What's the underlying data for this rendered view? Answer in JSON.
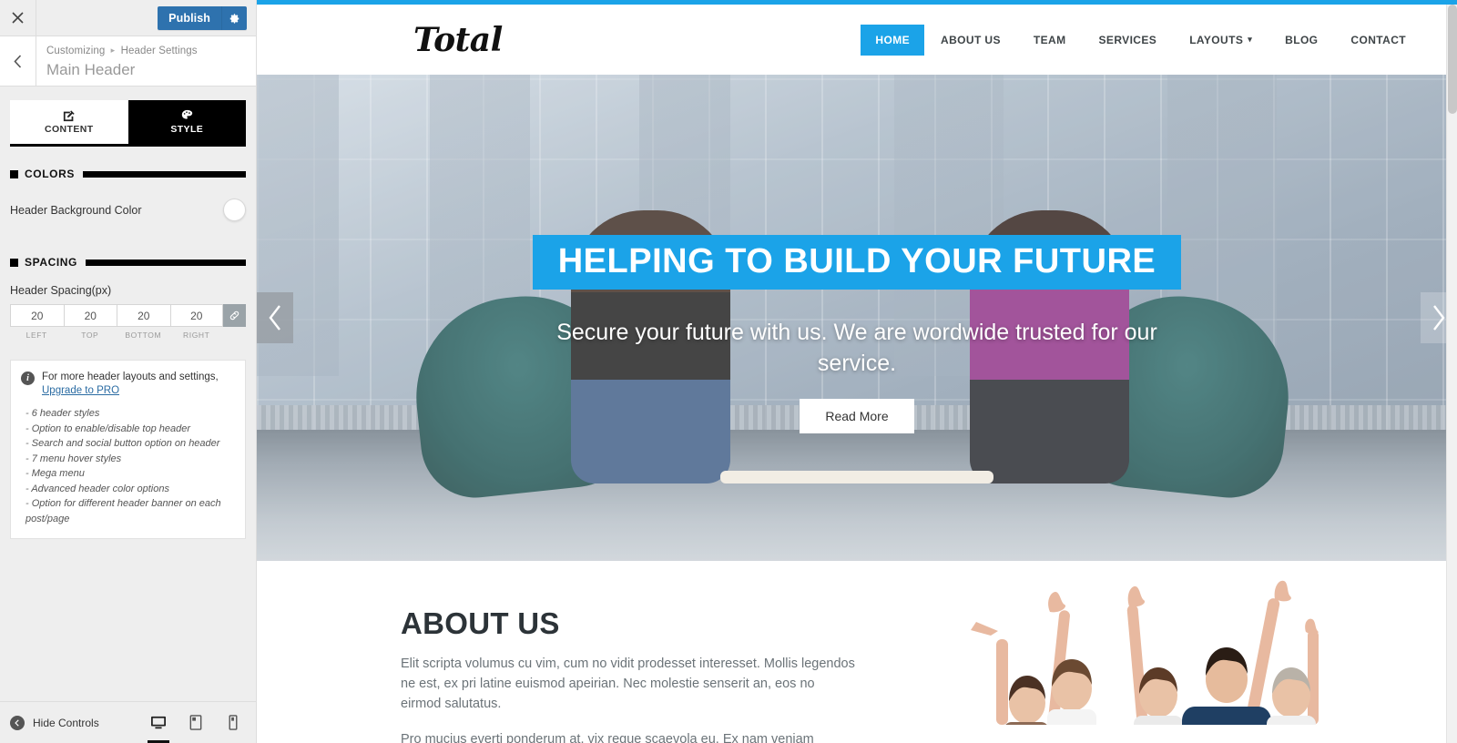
{
  "customizer": {
    "close_icon": "close-icon",
    "publish_label": "Publish",
    "gear_icon": "gear-icon",
    "back_icon": "chevron-left-icon",
    "breadcrumb": {
      "root": "Customizing",
      "separator": "▸",
      "section": "Header Settings"
    },
    "panel_title": "Main Header",
    "tabs": [
      {
        "label": "CONTENT",
        "icon": "edit-pencil-icon",
        "active": false
      },
      {
        "label": "STYLE",
        "icon": "paint-palette-icon",
        "active": true
      }
    ],
    "sections": [
      {
        "title": "COLORS"
      },
      {
        "title": "SPACING"
      }
    ],
    "color_control": {
      "label": "Header Background Color",
      "swatch_color": "#ffffff"
    },
    "spacing_control": {
      "label": "Header Spacing(px)",
      "fields": [
        {
          "value": "20",
          "sub": "LEFT"
        },
        {
          "value": "20",
          "sub": "TOP"
        },
        {
          "value": "20",
          "sub": "BOTTOM"
        },
        {
          "value": "20",
          "sub": "RIGHT"
        }
      ],
      "link_icon": "link-chain-icon"
    },
    "info_box": {
      "icon": "info-icon",
      "text_before": "For more header layouts and settings, ",
      "link_text": "Upgrade to PRO",
      "features": [
        "6 header styles",
        "Option to enable/disable top header",
        "Search and social button option on header",
        "7 menu hover styles",
        "Mega menu",
        "Advanced header color options",
        "Option for different header banner on each post/page"
      ]
    },
    "footer": {
      "hide_controls_label": "Hide Controls",
      "hide_icon": "collapse-arrow-icon",
      "devices": [
        {
          "name": "desktop-preview-icon",
          "active": true
        },
        {
          "name": "tablet-preview-icon",
          "active": false
        },
        {
          "name": "mobile-preview-icon",
          "active": false
        }
      ]
    }
  },
  "preview": {
    "accent_color": "#1ba3e8",
    "logo_text": "Total",
    "nav": [
      {
        "label": "HOME",
        "active": true,
        "has_caret": false
      },
      {
        "label": "ABOUT US",
        "active": false,
        "has_caret": false
      },
      {
        "label": "TEAM",
        "active": false,
        "has_caret": false
      },
      {
        "label": "SERVICES",
        "active": false,
        "has_caret": false
      },
      {
        "label": "LAYOUTS",
        "active": false,
        "has_caret": true
      },
      {
        "label": "BLOG",
        "active": false,
        "has_caret": false
      },
      {
        "label": "CONTACT",
        "active": false,
        "has_caret": false
      }
    ],
    "hero": {
      "title": "HELPING TO BUILD YOUR FUTURE",
      "subtitle": "Secure your future with us. We are wordwide trusted for our service.",
      "button_label": "Read More",
      "prev_icon": "chevron-left-icon",
      "next_icon": "chevron-right-icon"
    },
    "about": {
      "title": "ABOUT US",
      "paragraph1": "Elit scripta volumus cu vim, cum no vidit prodesset interesset. Mollis legendos ne est, ex pri latine euismod apeirian. Nec molestie senserit an, eos no eirmod salutatus.",
      "paragraph2": "Pro mucius everti ponderum at, vix reque scaevola eu. Ex nam veniam"
    }
  }
}
